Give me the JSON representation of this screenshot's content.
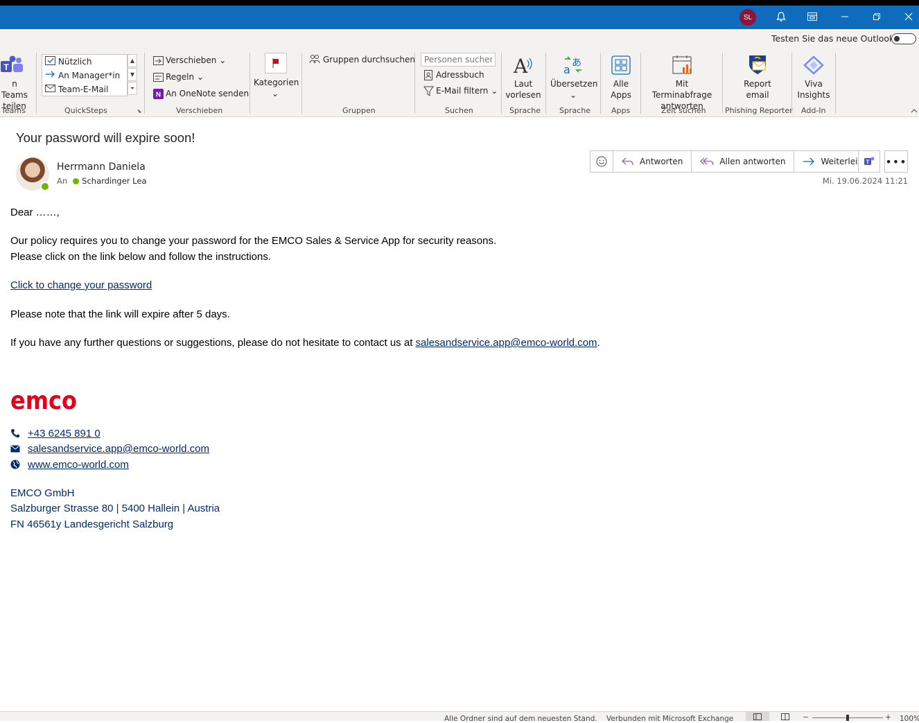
{
  "titlebar": {
    "user_initials": "SL"
  },
  "ribbon": {
    "new_outlook_label": "Testen Sie das neue Outlook",
    "teams": {
      "label_line1": "n Teams",
      "label_line2": "teilen",
      "group": "Teams"
    },
    "quicksteps": {
      "items": [
        "Nützlich",
        "An Manager*in",
        "Team-E-Mail"
      ],
      "group": "QuickSteps"
    },
    "move": {
      "move_label": "Verschieben",
      "rules_label": "Regeln",
      "onenote_label": "An OneNote senden",
      "group": "Verschieben"
    },
    "tags": {
      "categories_label": "Kategorien"
    },
    "groups": {
      "search_groups_label": "Gruppen durchsuchen",
      "group": "Gruppen"
    },
    "find": {
      "people_placeholder": "Personen suchen",
      "addressbook_label": "Adressbuch",
      "filter_label": "E-Mail filtern",
      "group": "Suchen"
    },
    "speech": {
      "read_label_line1": "Laut",
      "read_label_line2": "vorlesen",
      "group": "Sprache"
    },
    "language": {
      "translate_label": "Übersetzen",
      "group": "Sprache"
    },
    "apps": {
      "label_line1": "Alle",
      "label_line2": "Apps",
      "group": "Apps"
    },
    "findtime": {
      "label_line1": "Mit Terminabfrage",
      "label_line2": "antworten",
      "group": "Zeit suchen"
    },
    "phishing": {
      "label_line1": "Report",
      "label_line2": "email",
      "group": "Phishing Reporter"
    },
    "viva": {
      "label_line1": "Viva",
      "label_line2": "Insights",
      "group": "Add-In"
    }
  },
  "message": {
    "subject": "Your password will expire soon!",
    "sender": "Herrmann Daniela",
    "to_prefix": "An",
    "to_name": "Schardinger Lea",
    "date": "Mi. 19.06.2024 11:21",
    "actions": {
      "reply": "Antworten",
      "reply_all": "Allen antworten",
      "forward": "Weiterleiten"
    },
    "body": {
      "greeting": "Dear ……,",
      "para1_line1": "Our policy requires you to change your password for the EMCO Sales & Service App for security reasons.",
      "para1_line2": "Please click on the link below and follow the instructions.",
      "link_text": "Click to change your password",
      "note": "Please note that the link will expire after 5 days.",
      "contact_prefix": "If you have any further questions or suggestions, please do not hesitate to contact us at ",
      "contact_email": "salesandservice.app@emco-world.com",
      "contact_suffix": "."
    },
    "signature": {
      "logo_text": "emco",
      "phone": "+43 6245 891 0",
      "email": "salesandservice.app@emco-world.com",
      "web": "www.emco-world.com",
      "company": "EMCO GmbH",
      "address": "Salzburger Strasse 80 | 5400 Hallein | Austria",
      "registry": "FN 46561y Landesgericht Salzburg"
    }
  },
  "statusbar": {
    "sync_status": "Alle Ordner sind auf dem neuesten Stand.",
    "connection_status": "Verbunden mit Microsoft Exchange",
    "zoom": "100%"
  },
  "colors": {
    "titlebar": "#0f6cbd",
    "brand_red": "#e2001a",
    "link": "#002a6c",
    "presence": "#6bb700"
  }
}
